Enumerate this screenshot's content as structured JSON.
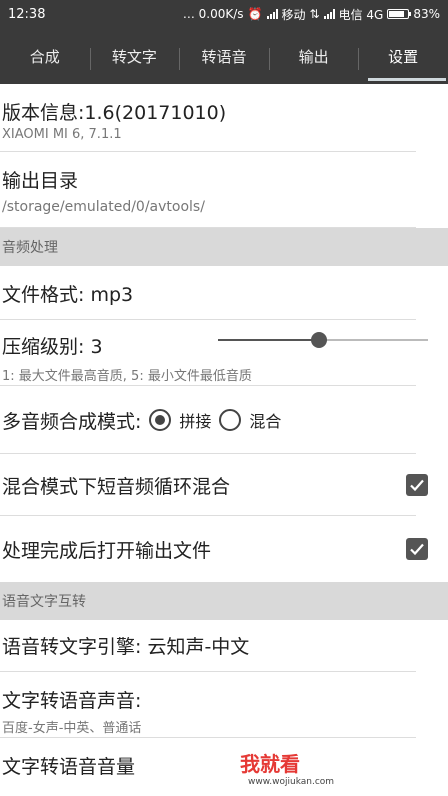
{
  "status_bar": {
    "time": "12:38",
    "network_speed": "… 0.00K/s",
    "carrier1": "移动",
    "carrier2": "电信 4G",
    "battery": "83%",
    "battery_level_percent": 83
  },
  "tabs": [
    {
      "label": "合成",
      "active": false
    },
    {
      "label": "转文字",
      "active": false
    },
    {
      "label": "转语音",
      "active": false
    },
    {
      "label": "输出",
      "active": false
    },
    {
      "label": "设置",
      "active": true
    }
  ],
  "settings": {
    "version": {
      "title": "版本信息:1.6(20171010)",
      "subtitle": "XIAOMI MI 6, 7.1.1"
    },
    "output_dir": {
      "title": "输出目录",
      "subtitle": "/storage/emulated/0/avtools/"
    },
    "section_audio": "音频处理",
    "file_format": {
      "title": "文件格式: mp3"
    },
    "compression": {
      "title": "压缩级别: 3",
      "subtitle": "1: 最大文件最高音质, 5: 最小文件最低音质",
      "value": 3,
      "min": 1,
      "max": 5
    },
    "merge_mode": {
      "title": "多音频合成模式:",
      "option1": "拼接",
      "option2": "混合",
      "selected": "拼接"
    },
    "loop_short": {
      "title": "混合模式下短音频循环混合",
      "checked": true
    },
    "open_after": {
      "title": "处理完成后打开输出文件",
      "checked": true
    },
    "section_speech": "语音文字互转",
    "stt_engine": {
      "title": "语音转文字引擎: 云知声-中文"
    },
    "tts_voice": {
      "title": "文字转语音声音:",
      "subtitle": "百度-女声-中英、普通话"
    },
    "tts_volume": {
      "title": "文字转语音音量"
    }
  },
  "watermark": {
    "big": "我就看",
    "small": "www.wojiukan.com"
  },
  "colors": {
    "appbar": "#3a3a3a",
    "section_bg": "#d9d9d9",
    "watermark_red": "#e53935"
  }
}
